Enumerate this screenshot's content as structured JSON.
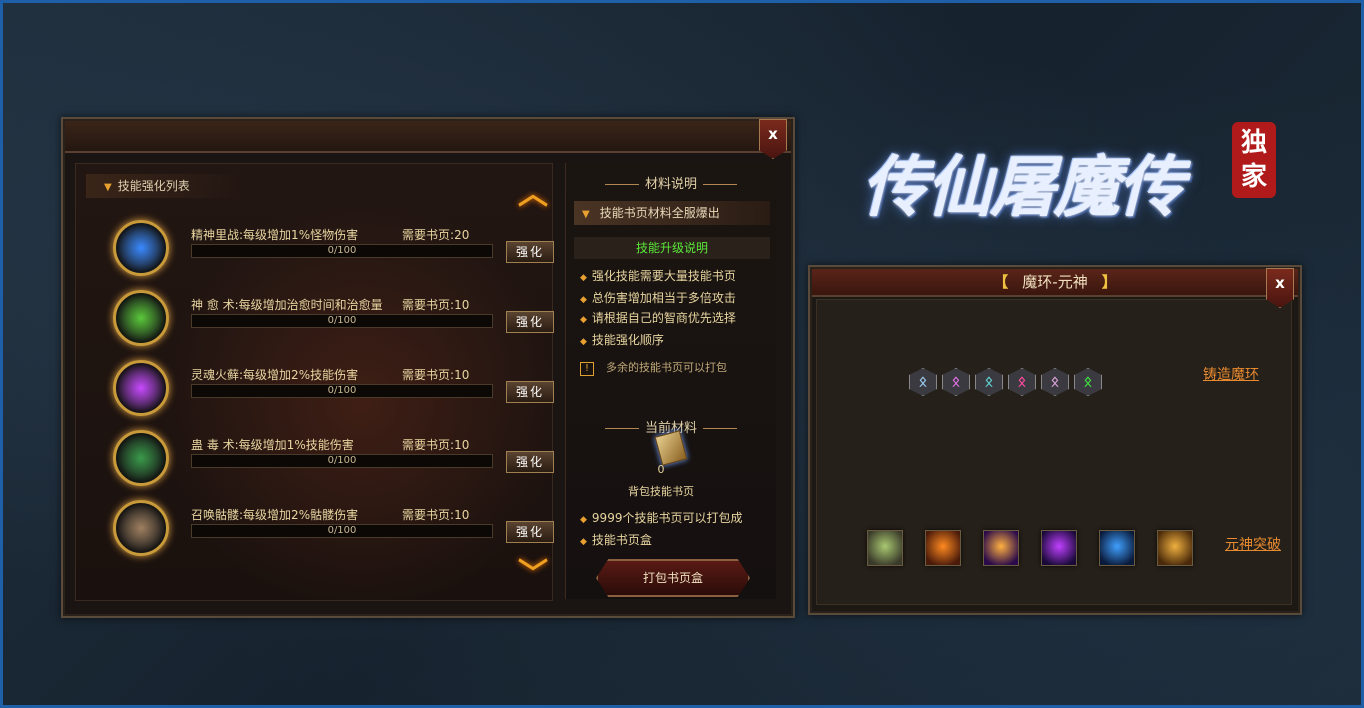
{
  "skill_panel": {
    "list_header": "技能强化列表",
    "skills": [
      {
        "name": "精神里战",
        "desc": ":每级增加1%怪物伤害",
        "req_label": "需要书页",
        "req_value": "20",
        "progress": "0/100",
        "btn": "强化",
        "icon_color": "#3a8aff"
      },
      {
        "name": "神 愈 术",
        "desc": ":每级增加治愈时间和治愈量",
        "req_label": "需要书页",
        "req_value": "10",
        "progress": "0/100",
        "btn": "强化",
        "icon_color": "#5ac83a"
      },
      {
        "name": "灵魂火藓",
        "desc": ":每级增加2%技能伤害",
        "req_label": "需要书页",
        "req_value": "10",
        "progress": "0/100",
        "btn": "强化",
        "icon_color": "#c84aff"
      },
      {
        "name": "蛊 毒 术",
        "desc": ":每级增加1%技能伤害",
        "req_label": "需要书页",
        "req_value": "10",
        "progress": "0/100",
        "btn": "强化",
        "icon_color": "#3a9a4a"
      },
      {
        "name": "召唤骷髅",
        "desc": ":每级增加2%骷髅伤害",
        "req_label": "需要书页",
        "req_value": "10",
        "progress": "0/100",
        "btn": "强化",
        "icon_color": "#a08060"
      }
    ],
    "close": "x"
  },
  "materials": {
    "title": "材料说明",
    "banner": "技能书页材料全服爆出",
    "upgrade_label": "技能升级说明",
    "bullets": [
      "强化技能需要大量技能书页",
      "总伤害增加相当于多倍攻击",
      "请根据自己的智商优先选择",
      "技能强化顺序"
    ],
    "notice_mark": "!",
    "notice": "多余的技能书页可以打包",
    "current_title": "当前材料",
    "current_count": "0",
    "current_name": "背包技能书页",
    "pack_bullets": [
      "9999个技能书页可以打包成",
      "技能书页盒"
    ],
    "pack_button": "打包书页盒"
  },
  "logo": {
    "text": "传仙屠魔传",
    "seal_1": "独",
    "seal_2": "家"
  },
  "soul_panel": {
    "title_open": "【",
    "title": "魔环-元神",
    "title_close": "】",
    "close": "x",
    "forge_link": "铸造魔环",
    "break_link": "元神突破",
    "runes": [
      {
        "color": "#9acaf0"
      },
      {
        "color": "#e070e0"
      },
      {
        "color": "#60d0d0"
      },
      {
        "color": "#ff4aa0"
      },
      {
        "color": "#d8a0d8"
      },
      {
        "color": "#40e040"
      }
    ],
    "gods": [
      {
        "from": "#3a3a2a",
        "to": "#a8c870"
      },
      {
        "from": "#4a1a0a",
        "to": "#ff8a20"
      },
      {
        "from": "#2a0a4a",
        "to": "#ffb040"
      },
      {
        "from": "#1a0a3a",
        "to": "#c040ff"
      },
      {
        "from": "#0a1a3a",
        "to": "#40a0ff"
      },
      {
        "from": "#4a2a0a",
        "to": "#f0b040"
      }
    ]
  }
}
